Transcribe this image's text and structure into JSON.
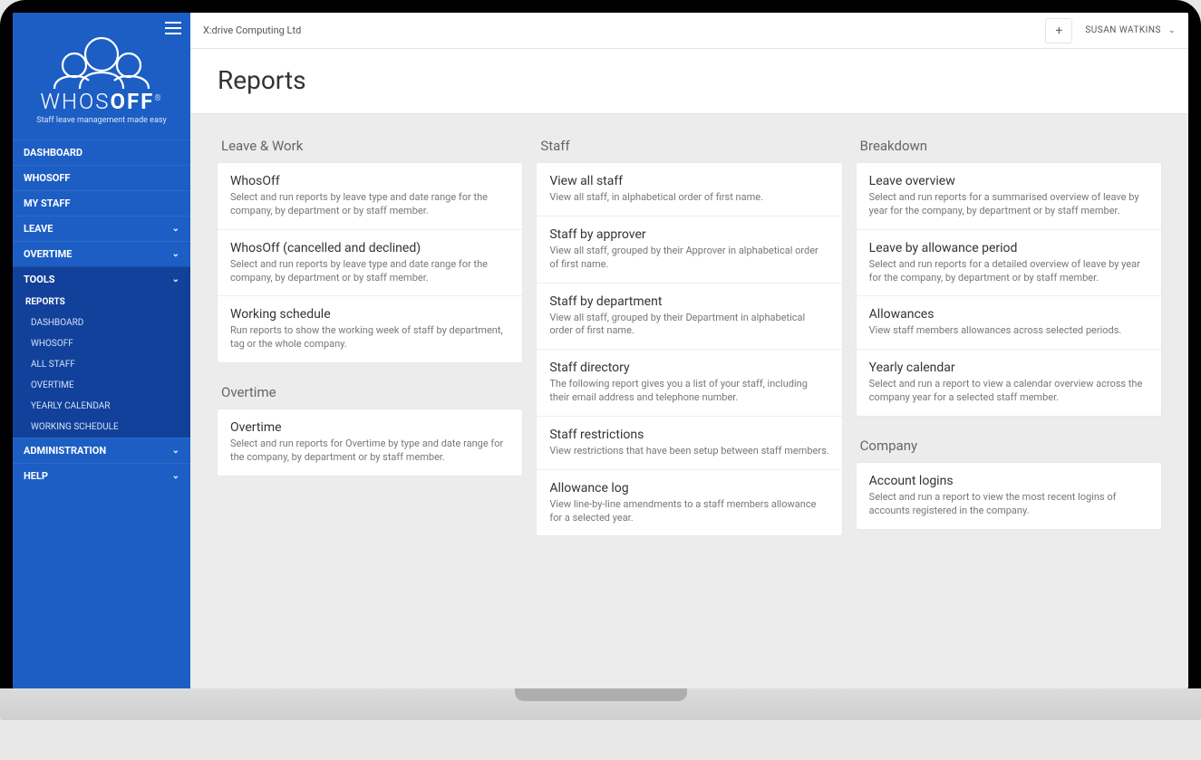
{
  "logo": {
    "brand_left": "WHOS",
    "brand_right": "OFF",
    "tagline": "Staff leave management made easy"
  },
  "topbar": {
    "company": "X:drive Computing Ltd",
    "user": "SUSAN WATKINS"
  },
  "page": {
    "title": "Reports"
  },
  "nav": {
    "dashboard": "DASHBOARD",
    "whosoff": "WHOSOFF",
    "mystaff": "MY STAFF",
    "leave": "LEAVE",
    "overtime": "OVERTIME",
    "tools": "TOOLS",
    "administration": "ADMINISTRATION",
    "help": "HELP"
  },
  "subnav": {
    "reports": "REPORTS",
    "dashboard": "DASHBOARD",
    "whosoff": "WHOSOFF",
    "allstaff": "ALL STAFF",
    "overtime": "OVERTIME",
    "yearly": "YEARLY CALENDAR",
    "working": "WORKING SCHEDULE"
  },
  "sections": {
    "leave_work": {
      "title": "Leave & Work",
      "whosoff": {
        "t": "WhosOff",
        "d": "Select and run reports by leave type and date range for the company, by department or by staff member."
      },
      "cancelled": {
        "t": "WhosOff (cancelled and declined)",
        "d": "Select and run reports by leave type and date range for the company, by department or by staff member."
      },
      "working": {
        "t": "Working schedule",
        "d": "Run reports to show the working week of staff by department, tag or the whole company."
      }
    },
    "overtime": {
      "title": "Overtime",
      "overtime": {
        "t": "Overtime",
        "d": "Select and run reports for Overtime by type and date range for the company, by department or by staff member."
      }
    },
    "staff": {
      "title": "Staff",
      "viewall": {
        "t": "View all staff",
        "d": "View all staff, in alphabetical order of first name."
      },
      "byapprover": {
        "t": "Staff by approver",
        "d": "View all staff, grouped by their Approver in alphabetical order of first name."
      },
      "bydept": {
        "t": "Staff by department",
        "d": "View all staff, grouped by their Department in alphabetical order of first name."
      },
      "directory": {
        "t": "Staff directory",
        "d": "The following report gives you a list of your staff, including their email address and telephone number."
      },
      "restrictions": {
        "t": "Staff restrictions",
        "d": "View restrictions that have been setup between staff members."
      },
      "allowance": {
        "t": "Allowance log",
        "d": "View line-by-line amendments to a staff members allowance for a selected year."
      }
    },
    "breakdown": {
      "title": "Breakdown",
      "overview": {
        "t": "Leave overview",
        "d": "Select and run reports for a summarised overview of leave by year for the company, by department or by staff member."
      },
      "byperiod": {
        "t": "Leave by allowance period",
        "d": "Select and run reports for a detailed overview of leave by year for the company, by department or by staff member."
      },
      "allowances": {
        "t": "Allowances",
        "d": "View staff members allowances across selected periods."
      },
      "yearly": {
        "t": "Yearly calendar",
        "d": "Select and run a report to view a calendar overview across the company year for a selected staff member."
      }
    },
    "company": {
      "title": "Company",
      "logins": {
        "t": "Account logins",
        "d": "Select and run a report to view the most recent logins of accounts registered in the company."
      }
    }
  }
}
